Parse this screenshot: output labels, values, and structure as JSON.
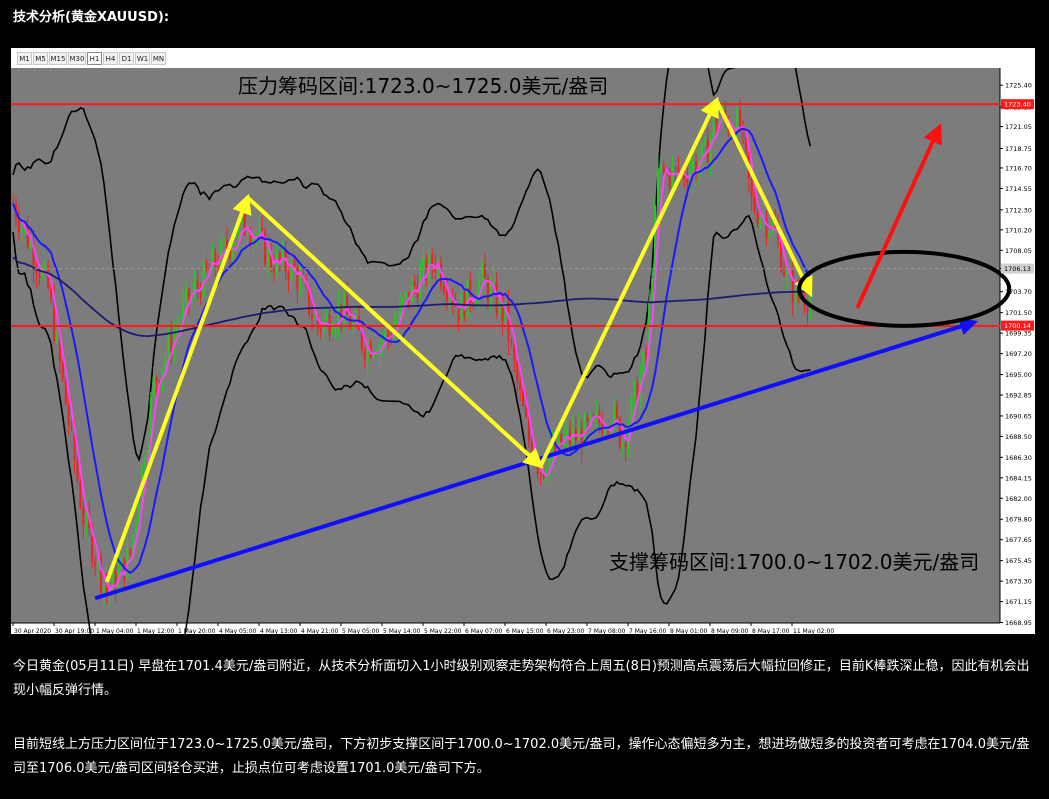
{
  "heading": "技术分析(黄金XAUUSD):",
  "toolbar": {
    "timeframes": [
      "M1",
      "M5",
      "M15",
      "M30",
      "H1",
      "H4",
      "D1",
      "W1",
      "MN"
    ],
    "active": "H1"
  },
  "paragraphs": [
    "今日黄金(05月11日) 早盘在1701.4美元/盎司附近，从技术分析面切入1小时级别观察走势架构符合上周五(8日)预测高点震荡后大幅拉回修正，目前K棒跌深止稳，因此有机会出现小幅反弹行情。",
    "目前短线上方压力区间位于1723.0~1725.0美元/盎司，下方初步支撑区间于1700.0~1702.0美元/盎司，操作心态偏短多为主，想进场做短多的投资者可考虑在1704.0美元/盎司至1706.0美元/盎司区间轻仓买进，止损点位可考虑设置1701.0美元/盎司下方。"
  ],
  "colors": {
    "chart_bg": "#7c7c7c",
    "axis_bg": "#ffffff",
    "resistance": "#ff1a1a",
    "support": "#ff1a1a",
    "trend_up": "#1010ff",
    "zigzag": "#ffff22",
    "target_arrow": "#ff1010",
    "ellipse": "#000000",
    "bull_candle": "#22cc22",
    "bear_candle": "#ee2222",
    "ma_fast": "#ff40ff",
    "ma_mid": "#1a1aff",
    "ma_slow": "#1c1c70",
    "bands": "#000000"
  },
  "chart_data": {
    "type": "candlestick",
    "symbol": "XAUUSD",
    "timeframe": "H1",
    "ylim": [
      1668.9,
      1727.2
    ],
    "y_ticks": [
      "1725.40",
      "1723.10",
      "1721.05",
      "1718.75",
      "1716.70",
      "1714.55",
      "1712.30",
      "1710.20",
      "1708.05",
      "1706.13",
      "1703.70",
      "1701.50",
      "1699.35",
      "1697.20",
      "1695.00",
      "1692.85",
      "1690.65",
      "1688.50",
      "1686.30",
      "1684.15",
      "1682.00",
      "1679.80",
      "1677.65",
      "1675.45",
      "1673.30",
      "1671.15",
      "1668.95"
    ],
    "x_ticks": [
      "30 Apr 2020",
      "30 Apr 19:00",
      "1 May 04:00",
      "1 May 12:00",
      "1 May 20:00",
      "4 May 05:00",
      "4 May 13:00",
      "4 May 21:00",
      "5 May 05:00",
      "5 May 14:00",
      "5 May 22:00",
      "6 May 07:00",
      "6 May 15:00",
      "6 May 23:00",
      "7 May 08:00",
      "7 May 16:00",
      "8 May 01:00",
      "8 May 09:00",
      "8 May 17:00",
      "11 May 02:00"
    ],
    "last_price": "1706.13",
    "resistance_price_label": "1723.40",
    "support_price_label": "1700.14",
    "annotations": {
      "resistance": "压力筹码区间:1723.0~1725.0美元/盎司",
      "support": "支撑筹码区间:1700.0~1702.0美元/盎司"
    },
    "resistance_level": 1723.4,
    "support_level": 1700.1,
    "zigzag": [
      [
        8,
        1673.2
      ],
      [
        20,
        1713.6
      ],
      [
        45,
        1685.4
      ],
      [
        60,
        1723.8
      ],
      [
        68,
        1703.5
      ]
    ],
    "trend_line": [
      [
        7,
        1671.5
      ],
      [
        82,
        1700.5
      ]
    ],
    "target_arrow": [
      [
        72,
        1702.0
      ],
      [
        79,
        1721.0
      ]
    ],
    "target_ellipse": {
      "cx": 76,
      "cy": 1704.0
    },
    "price_path": [
      [
        0,
        1713.0
      ],
      [
        3,
        1704.0
      ],
      [
        6,
        1680.0
      ],
      [
        8,
        1672.0
      ],
      [
        10,
        1676.0
      ],
      [
        12,
        1694.0
      ],
      [
        15,
        1703.0
      ],
      [
        18,
        1708.0
      ],
      [
        20,
        1711.0
      ],
      [
        22,
        1707.0
      ],
      [
        24,
        1706.0
      ],
      [
        26,
        1700.0
      ],
      [
        28,
        1702.0
      ],
      [
        30,
        1698.0
      ],
      [
        32,
        1699.0
      ],
      [
        34,
        1704.0
      ],
      [
        36,
        1707.0
      ],
      [
        38,
        1702.0
      ],
      [
        40,
        1705.0
      ],
      [
        42,
        1701.0
      ],
      [
        43,
        1694.0
      ],
      [
        44,
        1688.0
      ],
      [
        45,
        1685.0
      ],
      [
        47,
        1688.0
      ],
      [
        49,
        1689.0
      ],
      [
        51,
        1691.0
      ],
      [
        52,
        1688.0
      ],
      [
        54,
        1697.0
      ],
      [
        55,
        1716.0
      ],
      [
        57,
        1716.0
      ],
      [
        59,
        1718.0
      ],
      [
        60,
        1722.0
      ],
      [
        62,
        1721.0
      ],
      [
        63,
        1713.0
      ],
      [
        65,
        1710.0
      ],
      [
        66,
        1705.0
      ],
      [
        67,
        1703.0
      ],
      [
        68,
        1703.5
      ]
    ],
    "candles": [
      [
        1713.2,
        1714.3,
        1705.2,
        1706.3
      ],
      [
        1706.3,
        1709.7,
        1705.5,
        1709.3
      ],
      [
        1709.3,
        1710.2,
        1701.0,
        1701.4
      ],
      [
        1701.4,
        1703.2,
        1691.6,
        1693.4
      ],
      [
        1693.4,
        1694.4,
        1682.8,
        1683.5
      ],
      [
        1683.5,
        1684.5,
        1679.5,
        1680.6
      ],
      [
        1680.6,
        1681.6,
        1672.4,
        1673.4
      ],
      [
        1673.4,
        1675.7,
        1671.0,
        1672.0
      ],
      [
        1672.0,
        1677.6,
        1671.3,
        1677.0
      ],
      [
        1677.0,
        1687.5,
        1675.9,
        1686.3
      ],
      [
        1686.3,
        1695.6,
        1686.0,
        1695.0
      ],
      [
        1695.0,
        1698.8,
        1693.9,
        1697.0
      ],
      [
        1697.0,
        1703.1,
        1696.3,
        1702.6
      ],
      [
        1702.6,
        1703.6,
        1699.8,
        1701.2
      ],
      [
        1701.2,
        1705.9,
        1700.3,
        1705.0
      ],
      [
        1705.0,
        1707.6,
        1704.6,
        1707.5
      ],
      [
        1707.5,
        1711.0,
        1706.9,
        1710.0
      ],
      [
        1710.0,
        1710.1,
        1707.1,
        1708.2
      ],
      [
        1708.2,
        1709.4,
        1705.6,
        1706.4
      ],
      [
        1706.4,
        1707.6,
        1705.0,
        1705.6
      ],
      [
        1705.6,
        1706.6,
        1702.5,
        1703.6
      ],
      [
        1703.6,
        1704.9,
        1700.5,
        1701.3
      ],
      [
        1701.3,
        1704.6,
        1700.6,
        1703.4
      ],
      [
        1703.4,
        1704.2,
        1701.3,
        1702.0
      ],
      [
        1702.0,
        1703.1,
        1697.3,
        1698.2
      ],
      [
        1698.2,
        1700.0,
        1697.0,
        1699.5
      ],
      [
        1699.5,
        1702.7,
        1698.9,
        1702.3
      ],
      [
        1702.3,
        1705.1,
        1701.5,
        1704.6
      ],
      [
        1704.6,
        1708.5,
        1704.0,
        1707.8
      ],
      [
        1707.8,
        1708.2,
        1703.9,
        1704.6
      ],
      [
        1704.6,
        1705.5,
        1699.9,
        1701.3
      ],
      [
        1701.3,
        1704.7,
        1700.9,
        1703.8
      ],
      [
        1703.8,
        1708.9,
        1703.0,
        1707.8
      ],
      [
        1707.8,
        1708.7,
        1704.9,
        1705.1
      ],
      [
        1705.1,
        1705.8,
        1699.6,
        1700.2
      ],
      [
        1700.2,
        1701.0,
        1694.8,
        1695.3
      ],
      [
        1695.3,
        1696.2,
        1689.5,
        1690.5
      ],
      [
        1690.5,
        1690.9,
        1685.7,
        1686.6
      ],
      [
        1686.6,
        1687.2,
        1684.2,
        1685.0
      ],
      [
        1685.0,
        1687.2,
        1684.3,
        1686.4
      ],
      [
        1686.4,
        1688.4,
        1685.2,
        1688.0
      ],
      [
        1688.0,
        1689.9,
        1686.4,
        1688.8
      ],
      [
        1688.8,
        1691.1,
        1687.9,
        1690.2
      ],
      [
        1690.2,
        1691.7,
        1690.1,
        1691.1
      ],
      [
        1691.1,
        1692.0,
        1687.6,
        1688.2
      ],
      [
        1688.2,
        1689.0,
        1687.4,
        1688.0
      ],
      [
        1688.0,
        1696.0,
        1687.7,
        1695.3
      ],
      [
        1695.3,
        1703.1,
        1694.4,
        1702.6
      ],
      [
        1702.6,
        1717.0,
        1702.1,
        1716.2
      ],
      [
        1716.2,
        1717.1,
        1713.6,
        1714.4
      ],
      [
        1714.4,
        1717.0,
        1713.5,
        1716.8
      ],
      [
        1716.8,
        1717.8,
        1714.9,
        1716.1
      ],
      [
        1716.1,
        1719.1,
        1715.4,
        1718.1
      ],
      [
        1718.1,
        1721.5,
        1717.3,
        1720.7
      ],
      [
        1720.7,
        1724.1,
        1720.1,
        1722.9
      ],
      [
        1722.9,
        1723.5,
        1720.3,
        1720.5
      ],
      [
        1720.5,
        1721.5,
        1716.4,
        1717.0
      ],
      [
        1717.0,
        1718.1,
        1711.6,
        1712.4
      ],
      [
        1712.4,
        1712.9,
        1708.6,
        1709.4
      ],
      [
        1709.4,
        1709.9,
        1706.8,
        1707.2
      ],
      [
        1707.2,
        1708.1,
        1702.7,
        1703.7
      ],
      [
        1703.7,
        1705.7,
        1702.9,
        1705.0
      ],
      [
        1705.0,
        1705.7,
        1702.4,
        1703.5
      ]
    ]
  }
}
